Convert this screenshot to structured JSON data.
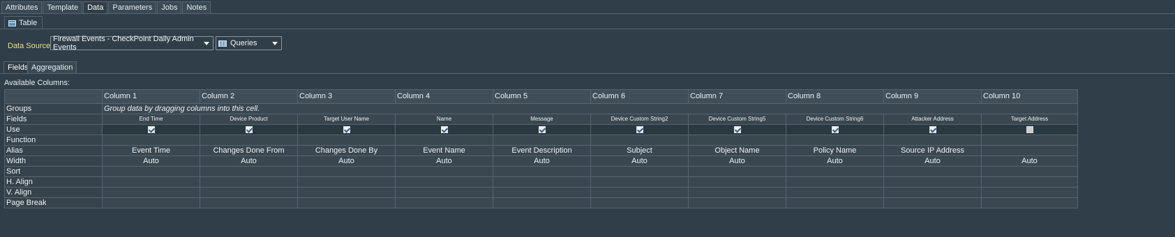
{
  "top_tabs": [
    "Attributes",
    "Template",
    "Data",
    "Parameters",
    "Jobs",
    "Notes"
  ],
  "active_top_tab": "Data",
  "sub_tab": {
    "label": "Table",
    "icon": "table-icon"
  },
  "data_source": {
    "label": "Data Source:",
    "selected": "Firewall Events - CheckPoint Daily Admin Events",
    "queries_label": "Queries",
    "queries_icon": "queries-icon"
  },
  "field_tabs": [
    "Fields",
    "Aggregation"
  ],
  "available_columns_label": "Available Columns:",
  "grid": {
    "columns": [
      "Column 1",
      "Column 2",
      "Column 3",
      "Column 4",
      "Column 5",
      "Column 6",
      "Column 7",
      "Column 8",
      "Column 9",
      "Column 10"
    ],
    "row_labels": {
      "groups": "Groups",
      "fields": "Fields",
      "use": "Use",
      "function": "Function",
      "alias": "Alias",
      "width": "Width",
      "sort": "Sort",
      "h_align": "H. Align",
      "v_align": "V. Align",
      "page_break": "Page Break"
    },
    "groups_hint": "Group data by dragging columns into this cell.",
    "fields": [
      "End Time",
      "Device Product",
      "Target User Name",
      "Name",
      "Message",
      "Device Custom String2",
      "Device Custom String5",
      "Device Custom String6",
      "Attacker Address",
      "Target Address"
    ],
    "use": [
      true,
      true,
      true,
      true,
      true,
      true,
      true,
      true,
      true,
      false
    ],
    "alias": [
      "Event Time",
      "Changes Done From",
      "Changes Done By",
      "Event Name",
      "Event Description",
      "Subject",
      "Object Name",
      "Policy Name",
      "Source IP Address",
      ""
    ],
    "width": [
      "Auto",
      "Auto",
      "Auto",
      "Auto",
      "Auto",
      "Auto",
      "Auto",
      "Auto",
      "Auto",
      "Auto"
    ]
  }
}
